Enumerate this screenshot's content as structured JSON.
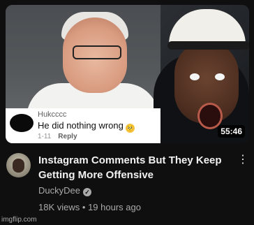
{
  "video": {
    "title": "Instagram Comments But They Keep Getting More Offensive",
    "duration": "55:46",
    "channel_name": "DuckyDee",
    "views": "18K views",
    "separator": "•",
    "age": "19 hours ago"
  },
  "thumbnail_comment": {
    "username": "Hukcccc",
    "text": "He did nothing wrong",
    "emoji": "🥺",
    "time": "1-11",
    "reply_label": "Reply"
  },
  "icons": {
    "more": "⋮",
    "verified": "✓"
  },
  "watermark": "imgflip.com"
}
